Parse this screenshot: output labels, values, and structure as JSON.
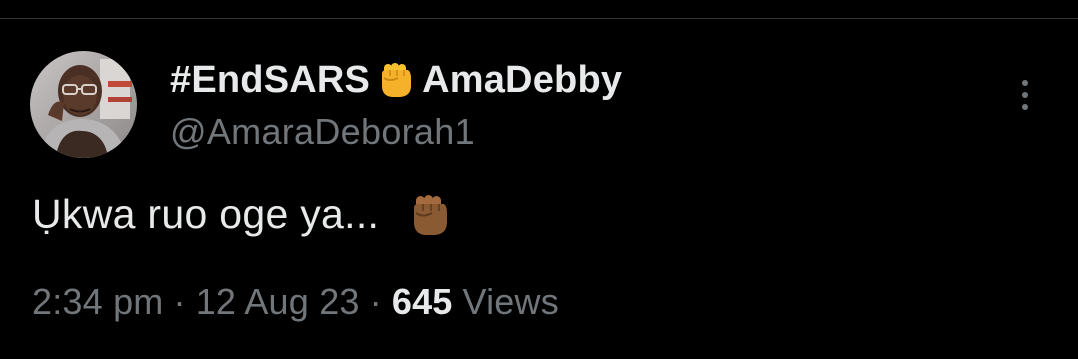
{
  "tweet": {
    "author": {
      "tag": "#EndSARS",
      "display_name": "AmaDebby",
      "handle": "@AmaraDeborah1",
      "avatar_icon": "profile-photo"
    },
    "text": "Ụkwa ruo oge ya...",
    "emoji": "raised-fist-medium-dark-skin",
    "time": "2:34 pm",
    "date": "12 Aug 23",
    "separator": "·",
    "views_count": "645",
    "views_label": "Views",
    "more_icon": "more-vertical-icon"
  },
  "colors": {
    "background": "#000000",
    "primary_text": "#e7e9ea",
    "secondary_text": "#71767b",
    "divider": "#2f3336",
    "fist_yellow": "#f7c130",
    "fist_brown": "#8a5a32"
  }
}
